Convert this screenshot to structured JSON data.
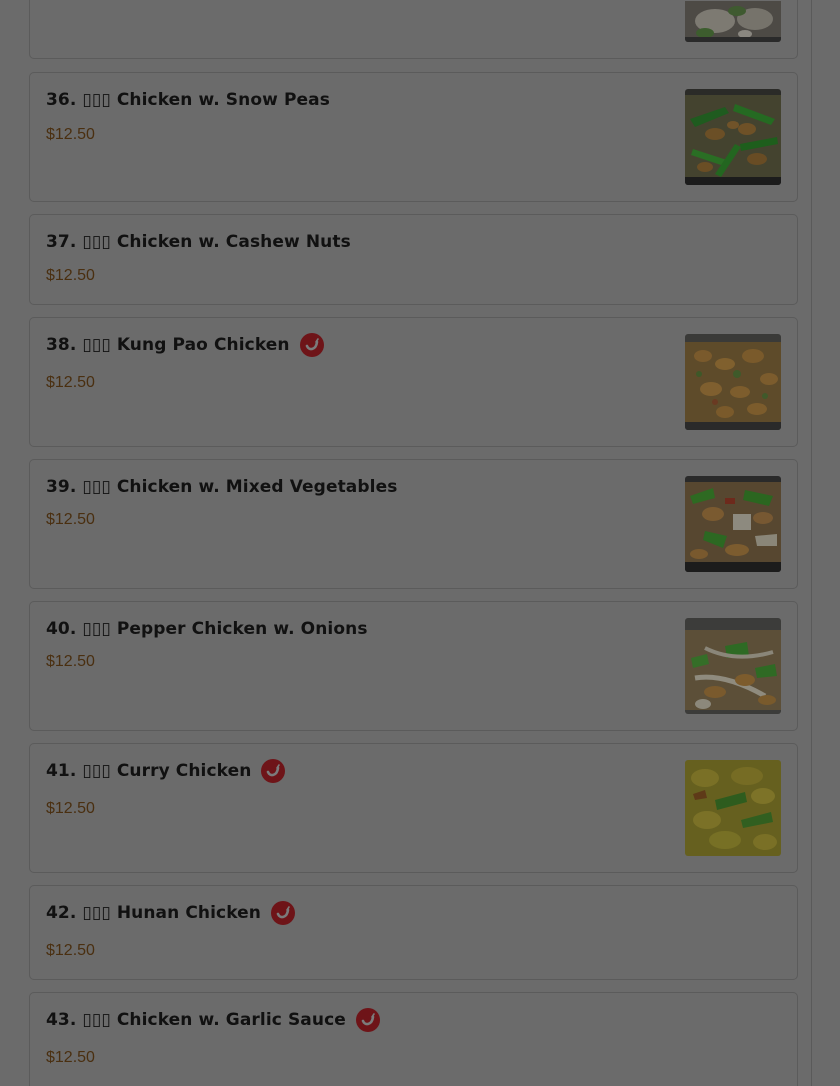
{
  "menu": {
    "items": [
      {
        "title": "36. ▯▯▯ Chicken w. Snow Peas",
        "price": "$12.50",
        "spicy": false,
        "photo": "snow-peas-chicken-photo"
      },
      {
        "title": "37. ▯▯▯ Chicken w. Cashew Nuts",
        "price": "$12.50",
        "spicy": false
      },
      {
        "title": "38. ▯▯▯ Kung Pao Chicken",
        "price": "$12.50",
        "spicy": true,
        "photo": "kung-pao-chicken-photo"
      },
      {
        "title": "39. ▯▯▯ Chicken w. Mixed Vegetables",
        "price": "$12.50",
        "spicy": false,
        "photo": "mixed-vegetables-chicken-photo"
      },
      {
        "title": "40. ▯▯▯ Pepper Chicken w. Onions",
        "price": "$12.50",
        "spicy": false,
        "photo": "pepper-chicken-photo"
      },
      {
        "title": "41. ▯▯▯ Curry Chicken",
        "price": "$12.50",
        "spicy": true,
        "photo": "curry-chicken-photo"
      },
      {
        "title": "42. ▯▯▯ Hunan Chicken",
        "price": "$12.50",
        "spicy": true
      },
      {
        "title": "43. ▯▯▯ Chicken w. Garlic Sauce",
        "price": "$12.50",
        "spicy": true
      }
    ]
  },
  "icons": {
    "spicy": "chili-pepper-icon"
  },
  "colors": {
    "overlay": "#6b6b6b",
    "spicy_badge": "#6e1418",
    "price_text": "#4a2f10"
  }
}
